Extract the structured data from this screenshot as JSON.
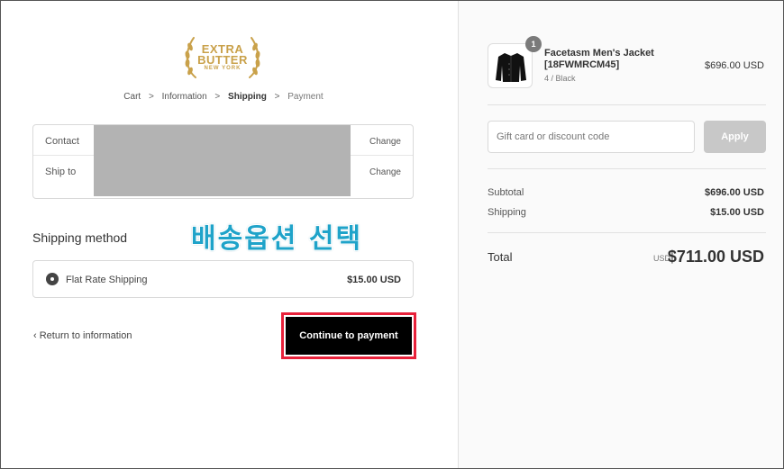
{
  "brand": {
    "line1": "EXTRA",
    "line2": "BUTTER",
    "line3": "NEW YORK",
    "color": "#c9a14a"
  },
  "breadcrumb": {
    "items": [
      {
        "label": "Cart"
      },
      {
        "label": "Information"
      },
      {
        "label": "Shipping"
      },
      {
        "label": "Payment"
      }
    ],
    "separator": ">"
  },
  "info": {
    "contact_label": "Contact",
    "ship_to_label": "Ship to",
    "change_label": "Change"
  },
  "annotation": {
    "text": "배송옵션 선택",
    "color": "#1fa3c9"
  },
  "shipping": {
    "heading": "Shipping method",
    "option_name": "Flat Rate Shipping",
    "option_price": "$15.00 USD"
  },
  "actions": {
    "return_label": "Return to information",
    "continue_label": "Continue to payment",
    "highlight_color": "#e8213a"
  },
  "product": {
    "quantity": "1",
    "name": "Facetasm Men's Jacket [18FWMRCM45]",
    "variant": "4 / Black",
    "price": "$696.00 USD"
  },
  "discount": {
    "placeholder": "Gift card or discount code",
    "apply_label": "Apply"
  },
  "summary": {
    "subtotal_label": "Subtotal",
    "subtotal_value": "$696.00 USD",
    "shipping_label": "Shipping",
    "shipping_value": "$15.00 USD",
    "total_label": "Total",
    "total_currency": "USD",
    "total_value": "$711.00 USD"
  }
}
